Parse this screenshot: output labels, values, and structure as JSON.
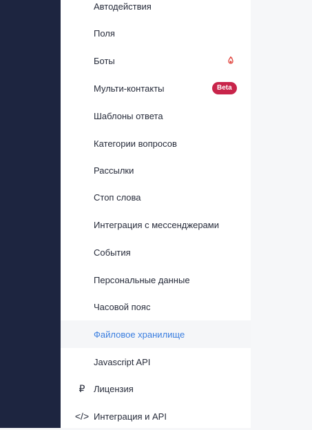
{
  "menu": {
    "items": [
      {
        "label": "Автодействия"
      },
      {
        "label": "Поля"
      },
      {
        "label": "Боты"
      },
      {
        "label": "Мульти-контакты",
        "badge": "Beta"
      },
      {
        "label": "Шаблоны ответа"
      },
      {
        "label": "Категории вопросов"
      },
      {
        "label": "Рассылки"
      },
      {
        "label": "Стоп слова"
      },
      {
        "label": "Интеграция с мессенджерами"
      },
      {
        "label": "События"
      },
      {
        "label": "Персональные данные"
      },
      {
        "label": "Часовой пояс"
      },
      {
        "label": "Файловое хранилище",
        "active": true
      },
      {
        "label": "Javascript API"
      }
    ],
    "top": [
      {
        "label": "Лицензия",
        "icon": "ruble-icon",
        "glyph": "₽"
      },
      {
        "label": "Интеграция и API",
        "icon": "code-icon",
        "glyph": "</>"
      }
    ]
  },
  "colors": {
    "rail": "#1d2540",
    "active_text": "#3a7ee0",
    "beta_badge": "#c8244a",
    "bot_icon": "#e0413a"
  }
}
